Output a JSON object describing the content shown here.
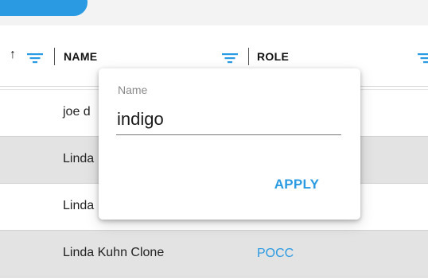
{
  "header": {
    "sort_arrow": "↑",
    "columns": [
      {
        "label": "NAME"
      },
      {
        "label": "ROLE"
      }
    ]
  },
  "table": {
    "rows": [
      {
        "name": "joe d",
        "role": ""
      },
      {
        "name": "Linda",
        "role": ""
      },
      {
        "name": "Linda",
        "role": ""
      },
      {
        "name": "Linda Kuhn Clone",
        "role": "POCC"
      }
    ]
  },
  "filter_popup": {
    "field_label": "Name",
    "field_value": "indigo",
    "apply_label": "APPLY"
  },
  "colors": {
    "accent": "#2a9be3",
    "row_alt": "#e3e3e3",
    "top_strip": "#f3f3f3"
  },
  "icons": {
    "sort": "arrow-up-icon",
    "filter": "filter-lines-icon"
  }
}
